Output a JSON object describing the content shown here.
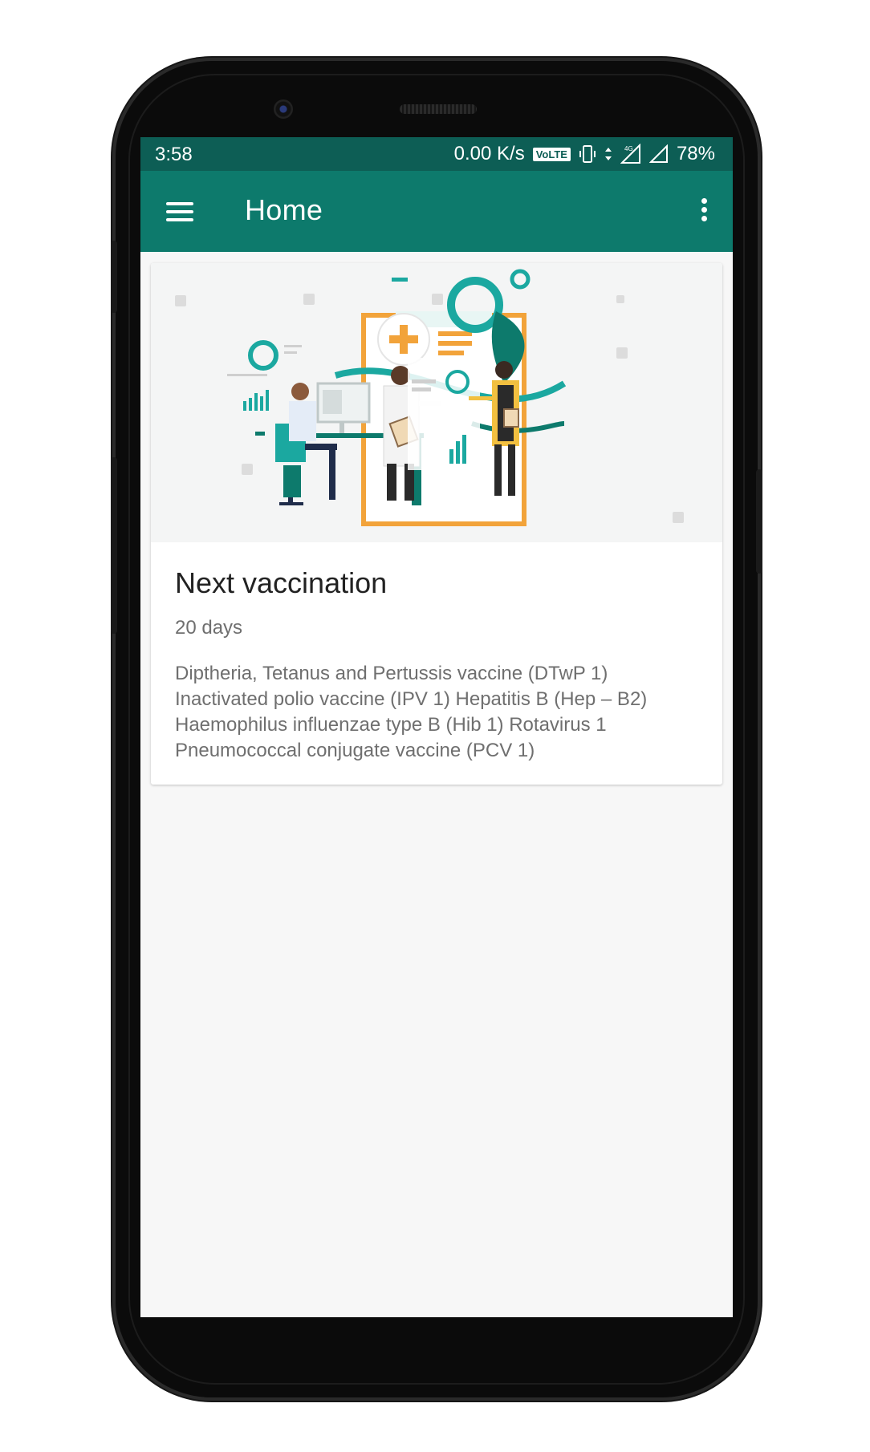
{
  "status_bar": {
    "time": "3:58",
    "network_speed": "0.00 K/s",
    "volte_badge": "VoLTE",
    "battery": "78%",
    "icons": [
      "vibrate-icon",
      "data-arrows-icon",
      "signal-4g-icon",
      "signal-icon"
    ]
  },
  "app_bar": {
    "title": "Home",
    "menu_icon": "hamburger-menu-icon",
    "overflow_icon": "more-vert-icon"
  },
  "card": {
    "illustration": "medical-team-illustration",
    "title": "Next vaccination",
    "days": "20 days",
    "description": "Diptheria, Tetanus and Pertussis vaccine (DTwP 1) Inactivated polio vaccine (IPV 1) Hepatitis B  (Hep – B2) Haemophilus influenzae type B (Hib 1) Rotavirus 1 Pneumococcal conjugate vaccine (PCV 1)"
  },
  "colors": {
    "status_bar": "#0d5e55",
    "app_bar": "#0d7a6c",
    "background": "#f7f7f7",
    "accent_orange": "#f2a33a"
  }
}
